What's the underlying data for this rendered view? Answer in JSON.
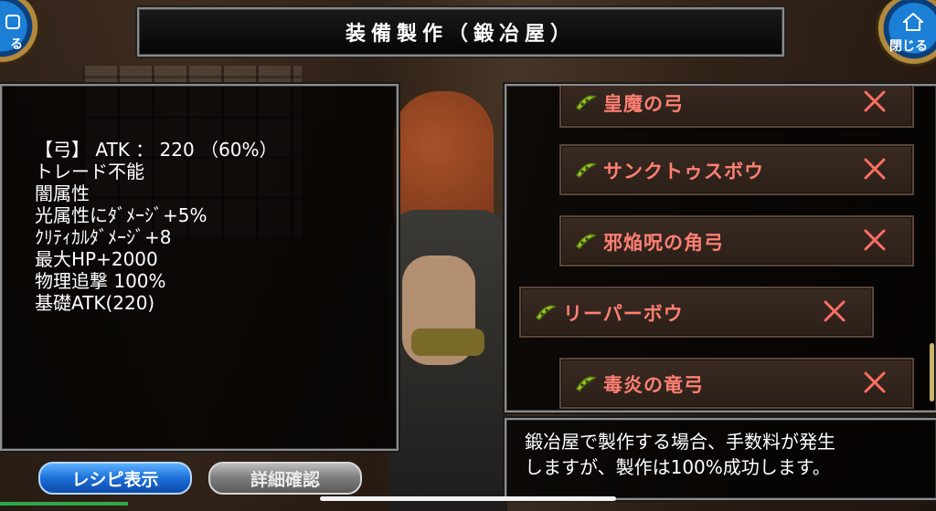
{
  "header": {
    "title": "装備製作（鍛冶屋）"
  },
  "back_button": {
    "label": "る"
  },
  "close_button": {
    "label": "閉じる"
  },
  "stats": [
    "【弓】 ATK ： 220 （60%）",
    "トレード不能",
    "闇属性",
    "光属性にﾀﾞﾒｰｼﾞ+5%",
    "ｸﾘﾃｨｶﾙﾀﾞﾒｰｼﾞ+8",
    "最大HP+2000",
    "物理追撃 100%",
    "基礎ATK(220)"
  ],
  "recipes": [
    {
      "name": "皇魔の弓",
      "icon": "bow-icon",
      "status_icon": "x-icon"
    },
    {
      "name": "サンクトゥスボウ",
      "icon": "bow-icon",
      "status_icon": "x-icon"
    },
    {
      "name": "邪焔呪の角弓",
      "icon": "bow-icon",
      "status_icon": "x-icon"
    },
    {
      "name": "リーパーボウ",
      "icon": "bow-icon",
      "status_icon": "x-icon",
      "selected": true
    },
    {
      "name": "毒炎の竜弓",
      "icon": "bow-icon",
      "status_icon": "x-icon"
    }
  ],
  "description": {
    "line1": "鍛冶屋で製作する場合、手数料が発生",
    "line2": "しますが、製作は100%成功します。"
  },
  "buttons": {
    "recipe_display": "レシピ表示",
    "detail_confirm": "詳細確認"
  },
  "colors": {
    "recipe_text": "#ff7f73",
    "x_mark": "#ff6e63",
    "bow_icon": "#9fd12a",
    "primary_button": "#1c6fd8",
    "disabled_button": "#7c7c7c"
  }
}
